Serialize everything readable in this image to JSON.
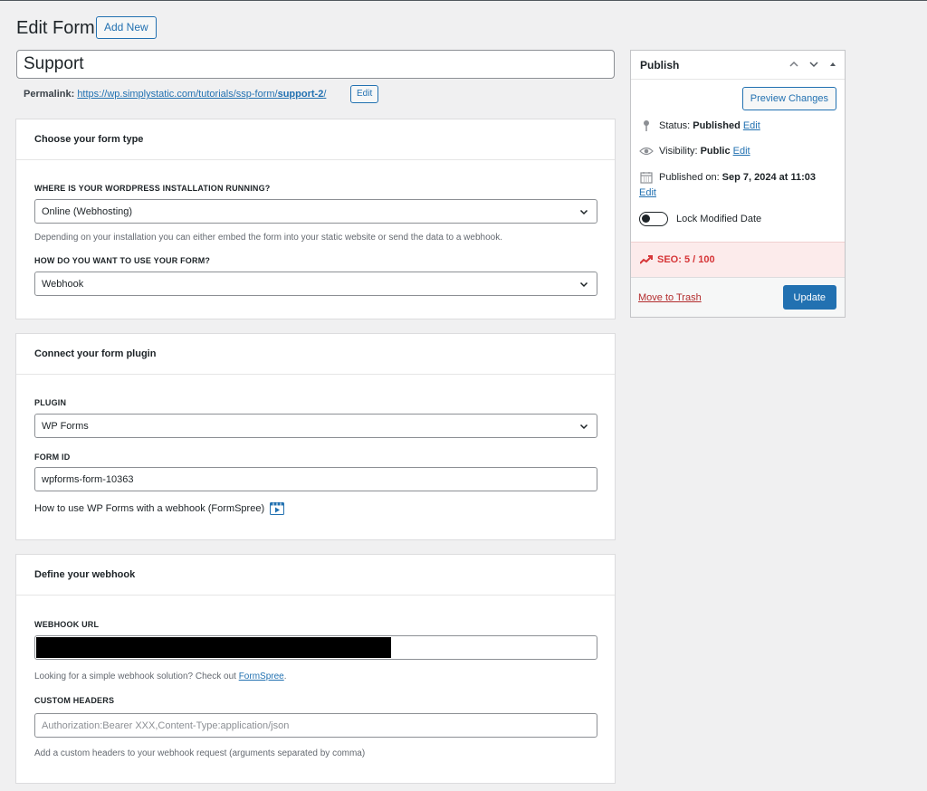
{
  "header": {
    "title": "Edit Form",
    "add_new": "Add New"
  },
  "post": {
    "title": "Support",
    "permalink_label": "Permalink:",
    "permalink_base": "https://wp.simplystatic.com/tutorials/ssp-form/",
    "permalink_slug": "support-2",
    "permalink_trail": "/",
    "permalink_edit": "Edit"
  },
  "form_type": {
    "heading": "Choose your form type",
    "installation_label": "WHERE IS YOUR WORDPRESS INSTALLATION RUNNING?",
    "installation_value": "Online (Webhosting)",
    "installation_help": "Depending on your installation you can either embed the form into your static website or send the data to a webhook.",
    "usage_label": "HOW DO YOU WANT TO USE YOUR FORM?",
    "usage_value": "Webhook"
  },
  "plugin": {
    "heading": "Connect your form plugin",
    "plugin_label": "PLUGIN",
    "plugin_value": "WP Forms",
    "form_id_label": "FORM ID",
    "form_id_value": "wpforms-form-10363",
    "howto_text": "How to use WP Forms with a webhook (FormSpree)"
  },
  "webhook": {
    "heading": "Define your webhook",
    "url_label": "WEBHOOK URL",
    "url_help_prefix": "Looking for a simple webhook solution? Check out ",
    "url_help_link": "FormSpree",
    "url_help_suffix": ".",
    "headers_label": "CUSTOM HEADERS",
    "headers_placeholder": "Authorization:Bearer XXX,Content-Type:application/json",
    "headers_help": "Add a custom headers to your webhook request (arguments separated by comma)"
  },
  "publish": {
    "title": "Publish",
    "preview_button": "Preview Changes",
    "status_label": "Status:",
    "status_value": "Published",
    "visibility_label": "Visibility:",
    "visibility_value": "Public",
    "published_label": "Published on:",
    "published_value": "Sep 7, 2024 at 11:03",
    "edit": "Edit",
    "lock_label": "Lock Modified Date",
    "seo_text": "SEO: 5 / 100",
    "trash": "Move to Trash",
    "update_button": "Update"
  },
  "colors": {
    "primary": "#2271b1",
    "danger": "#d63638",
    "seo_bg": "#fcebeb"
  }
}
